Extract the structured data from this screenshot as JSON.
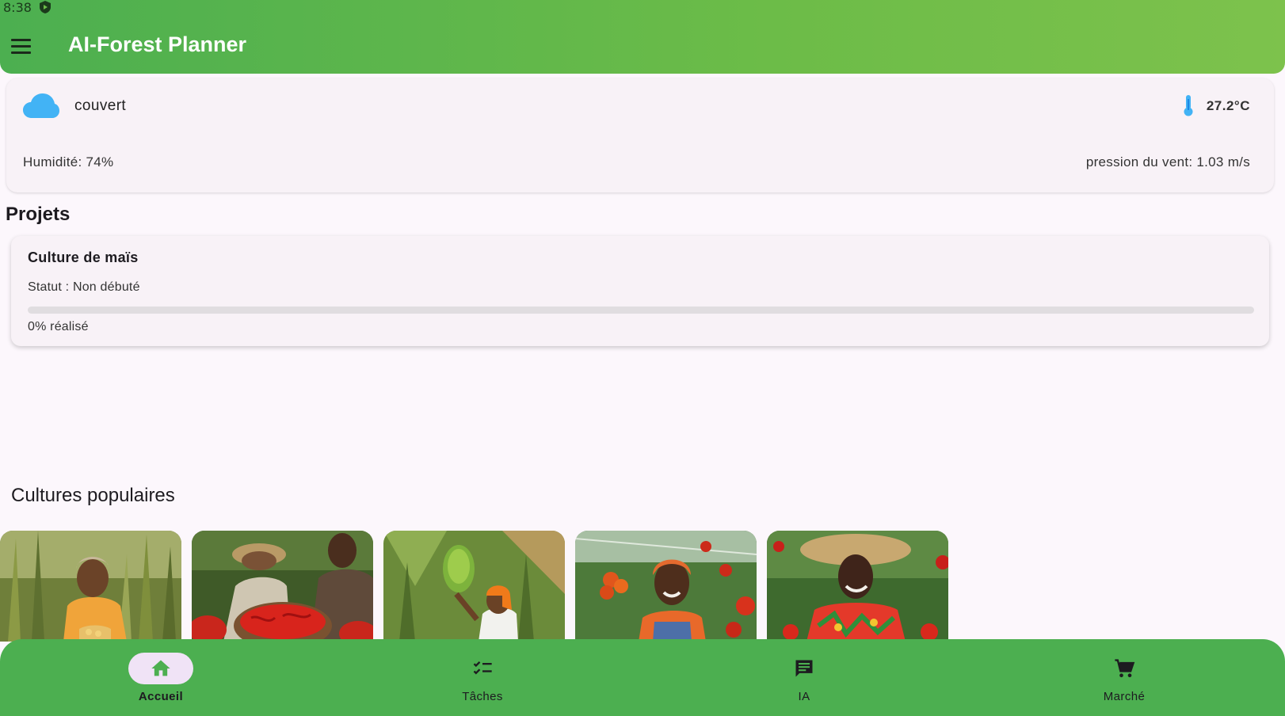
{
  "status_bar": {
    "time": "8:38"
  },
  "app_bar": {
    "title": "AI-Forest Planner",
    "menu_icon": "menu-icon"
  },
  "weather": {
    "condition": "couvert",
    "temperature": "27.2°C",
    "humidity": "Humidité: 74%",
    "wind": "pression du vent: 1.03 m/s",
    "cloud_color": "#42b3f5",
    "thermo_color": "#42b3f5"
  },
  "projects": {
    "title": "Projets",
    "items": [
      {
        "name": "Culture de maïs",
        "status": "Statut : Non débuté",
        "progress": 0,
        "progress_text": "0% réalisé"
      }
    ]
  },
  "popular": {
    "title": "Cultures populaires",
    "items": [
      {
        "image": "maize-farmer-photo"
      },
      {
        "image": "chili-harvest-photo"
      },
      {
        "image": "banana-farmer-photo"
      },
      {
        "image": "tomato-farmer-photo"
      },
      {
        "image": "pepper-farmer-photo"
      }
    ]
  },
  "bottom_nav": {
    "items": [
      {
        "label": "Accueil",
        "icon": "home-icon",
        "active": true
      },
      {
        "label": "Tâches",
        "icon": "checklist-icon",
        "active": false
      },
      {
        "label": "IA",
        "icon": "chat-icon",
        "active": false
      },
      {
        "label": "Marché",
        "icon": "cart-icon",
        "active": false
      }
    ]
  },
  "colors": {
    "primary": "#4caf50",
    "accent_light": "#7dc24c",
    "background": "#fcf7fc",
    "nav_active_pill": "#f0e3f6"
  }
}
